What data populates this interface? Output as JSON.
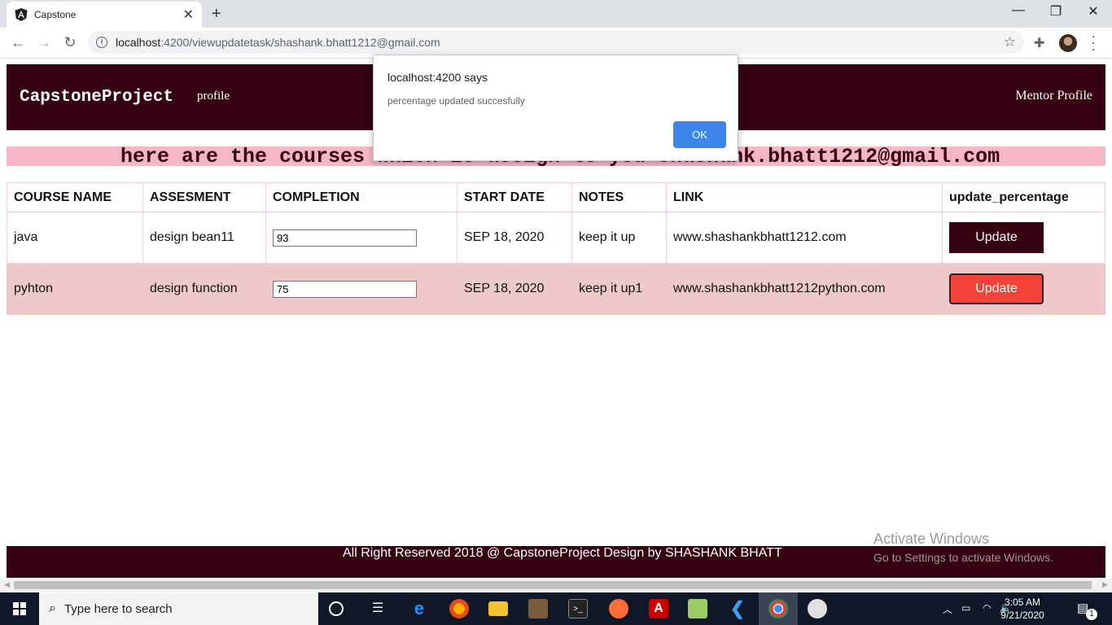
{
  "browser": {
    "tab_title": "Capstone",
    "tab_close": "✕",
    "new_tab": "+",
    "window_controls": [
      "—",
      "❐",
      "✕"
    ],
    "url_host": "localhost",
    "url_path": ":4200/viewupdatetask/shashank.bhatt1212@gmail.com",
    "icons": [
      "back-icon",
      "forward-icon",
      "reload-icon",
      "info-icon",
      "star-icon",
      "extensions-icon",
      "avatar",
      "menu-icon"
    ]
  },
  "app": {
    "brand": "CapstoneProject",
    "nav_profile": "profile",
    "nav_mentor_profile": "Mentor Profile",
    "colors": {
      "primary": "#350010",
      "banner": "#f7b6c5",
      "alt_row": "#efc9c9",
      "danger": "#f44336"
    }
  },
  "banner": {
    "text": "here are the courses which is assign to you shashank.bhatt1212@gmail.com"
  },
  "table": {
    "headers": [
      "COURSE NAME",
      "ASSESMENT",
      "COMPLETION",
      "START DATE",
      "NOTES",
      "LINK",
      "update_percentage"
    ],
    "rows": [
      {
        "course": "java",
        "assessment": "design bean11",
        "completion": "93",
        "start_date": "SEP 18, 2020",
        "notes": "keep it up",
        "link": "www.shashankbhatt1212.com",
        "button": "Update"
      },
      {
        "course": "pyhton",
        "assessment": "design function",
        "completion": "75",
        "start_date": "SEP 18, 2020",
        "notes": "keep it up1",
        "link": "www.shashankbhatt1212python.com",
        "button": "Update"
      }
    ]
  },
  "footer": {
    "text": "All Right Reserved 2018 @ CapstoneProject Design by SHASHANK BHATT"
  },
  "watermark": {
    "line1": "Activate Windows",
    "line2": "Go to Settings to activate Windows."
  },
  "dialog": {
    "title": "localhost:4200 says",
    "message": "percentage updated succesfully",
    "ok_label": "OK"
  },
  "taskbar": {
    "search_placeholder": "Type here to search",
    "time": "3:05 AM",
    "date": "9/21/2020",
    "notification_count": "1",
    "apps": [
      "cortana-icon",
      "task-view-icon",
      "edge-icon",
      "firefox-icon",
      "file-explorer-icon",
      "game-icon",
      "terminal-icon",
      "postman-icon",
      "acrobat-icon",
      "notepad-icon",
      "vscode-icon",
      "chrome-icon",
      "paint-icon"
    ]
  }
}
